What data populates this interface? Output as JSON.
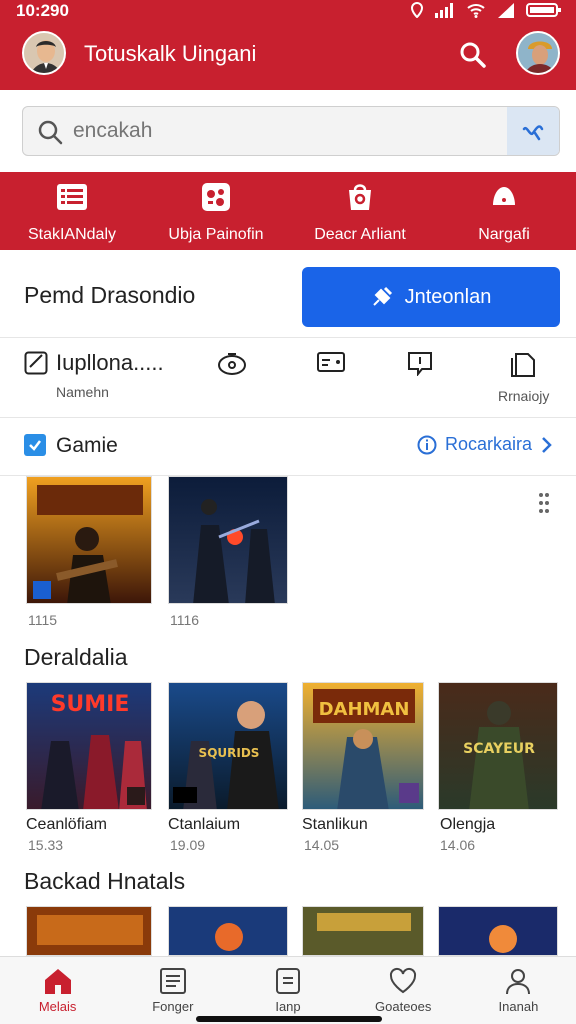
{
  "status_bar": {
    "time": "10:290"
  },
  "header": {
    "title": "Totuskalk Uingani"
  },
  "search": {
    "placeholder": "encakah",
    "value": ""
  },
  "categories": [
    {
      "label": "StakIANdaly",
      "icon": "list-icon"
    },
    {
      "label": "Ubja Painofin",
      "icon": "gamepad-icon"
    },
    {
      "label": "Deacr Arliant",
      "icon": "bag-icon"
    },
    {
      "label": "Nargafi",
      "icon": "bell-icon"
    }
  ],
  "promo": {
    "title": "Pemd Drasondio",
    "button_label": "Jnteonlan"
  },
  "tools": {
    "first_label": "Iupllona.....",
    "first_sub": "Namehn",
    "last_label": "Rrnaiojy"
  },
  "section": {
    "title": "Gamie",
    "link_label": "Rocarkaira"
  },
  "featured_tiles": [
    {
      "caption": "1115"
    },
    {
      "caption": "1116"
    }
  ],
  "row2": {
    "title": "Deraldalia",
    "tiles": [
      {
        "name": "Ceanlöfiam",
        "time": "15.33",
        "art_text": "SUMIE"
      },
      {
        "name": "Ctanlaium",
        "time": "19.09",
        "art_text": "SQURIDS"
      },
      {
        "name": "Stanlikun",
        "time": "14.05",
        "art_text": "DAHMAN"
      },
      {
        "name": "Olengja",
        "time": "14.06",
        "art_text": "SCAYEUR"
      }
    ]
  },
  "row3": {
    "title": "Backad Hnatals"
  },
  "bottom_nav": [
    {
      "label": "Melais",
      "icon": "home-icon",
      "active": true
    },
    {
      "label": "Fonger",
      "icon": "document-icon",
      "active": false
    },
    {
      "label": "Ianp",
      "icon": "tablet-icon",
      "active": false
    },
    {
      "label": "Goateoes",
      "icon": "heart-icon",
      "active": false
    },
    {
      "label": "Inanah",
      "icon": "person-icon",
      "active": false
    }
  ],
  "colors": {
    "brand": "#c8202f",
    "accent": "#1a64e8",
    "link": "#2a6fd6"
  }
}
